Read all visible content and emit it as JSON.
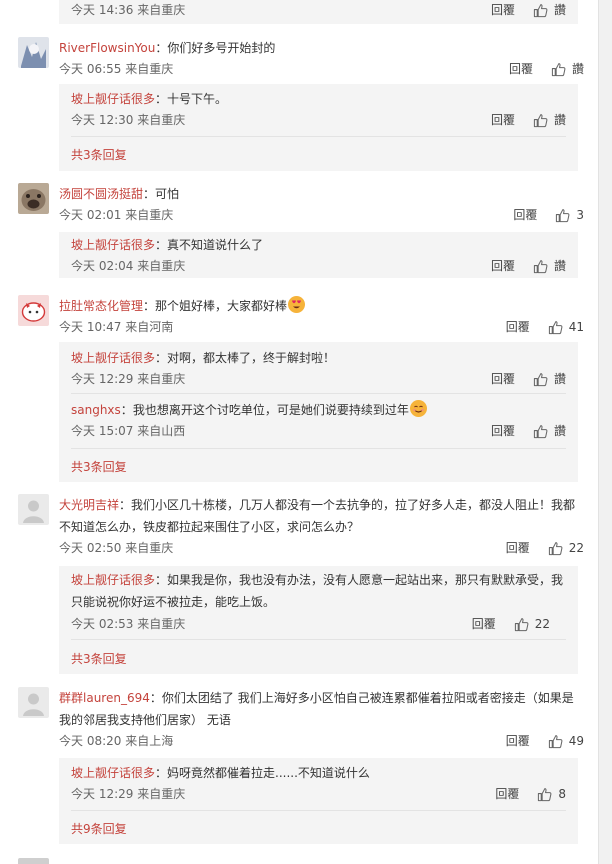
{
  "top_partial": {
    "meta": "今天 14:36 来自重庆",
    "reply": "回覆",
    "like": "讚"
  },
  "comments": [
    {
      "user": "RiverFlowsinYou",
      "sep": "：",
      "text": "你们好多号开始封的",
      "meta": "今天 06:55 来自重庆",
      "reply": "回覆",
      "like": "讚",
      "subs": [
        {
          "user": "坡上靓仔话很多",
          "sep": "：",
          "text": "十号下午。",
          "meta": "今天 12:30 来自重庆",
          "reply": "回覆",
          "like": "讚"
        }
      ],
      "more": "共3条回复"
    },
    {
      "user": "汤圆不圆汤挺甜",
      "sep": "：",
      "text": "可怕",
      "meta": "今天 02:01 来自重庆",
      "reply": "回覆",
      "like": "3",
      "subs": [
        {
          "user": "坡上靓仔话很多",
          "sep": "：",
          "text": "真不知道说什么了",
          "meta": "今天 02:04 来自重庆",
          "reply": "回覆",
          "like": "讚"
        }
      ]
    },
    {
      "user": "拉肚常态化管理",
      "sep": "：",
      "text": "那个姐好棒，大家都好棒",
      "meta": "今天 10:47 来自河南",
      "reply": "回覆",
      "like": "41",
      "subs": [
        {
          "user": "坡上靓仔话很多",
          "sep": "：",
          "text": "对啊，都太棒了，终于解封啦！",
          "meta": "今天 12:29 来自重庆",
          "reply": "回覆",
          "like": "讚"
        },
        {
          "user": "sanghxs",
          "sep": "：",
          "text": "我也想离开这个讨吃单位，可是她们说要持续到过年",
          "meta": "今天 15:07 来自山西",
          "reply": "回覆",
          "like": "讚"
        }
      ],
      "more": "共3条回复"
    },
    {
      "user": "大光明吉祥",
      "sep": "：",
      "text": "我们小区几十栋楼，几万人都没有一个去抗争的，拉了好多人走，都没人阻止！我都",
      "text2": "不知道怎么办，铁皮都拉起来围住了小区，求问怎么办？",
      "meta": "今天 02:50 来自重庆",
      "reply": "回覆",
      "like": "22",
      "subs": [
        {
          "user": "坡上靓仔话很多",
          "sep": "：",
          "text": "如果我是你，我也没有办法，没有人愿意一起站出来，那只有默默承受，我",
          "text2": "只能说祝你好运不被拉走，能吃上饭。",
          "meta": "今天 02:53 来自重庆",
          "reply": "回覆",
          "like": "22"
        }
      ],
      "more": "共3条回复"
    },
    {
      "user": "群群lauren_694",
      "sep": "：",
      "text": "你们太团结了 我们上海好多小区怕自己被连累都催着拉阳或者密接走（如果是",
      "text2": "我的邻居我支持他们居家） 无语",
      "meta": "今天 08:20 来自上海",
      "reply": "回覆",
      "like": "49",
      "subs": [
        {
          "user": "坡上靓仔话很多",
          "sep": "：",
          "text": "妈呀竟然都催着拉走......不知道说什么",
          "meta": "今天 12:29 来自重庆",
          "reply": "回覆",
          "like": "8"
        }
      ],
      "more": "共9条回复"
    }
  ],
  "colors": {
    "username": "#c4433c",
    "sub_bg": "#f4f4f4",
    "text": "#333333"
  }
}
